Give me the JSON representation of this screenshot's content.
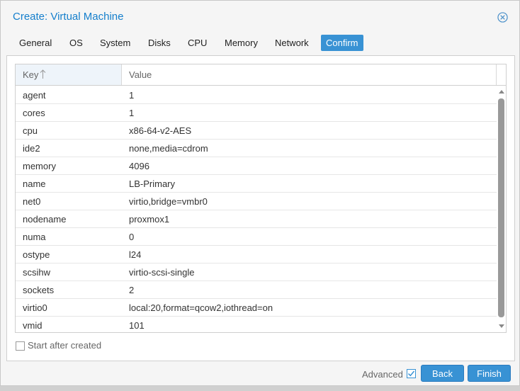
{
  "window": {
    "title": "Create: Virtual Machine"
  },
  "tabs": [
    {
      "label": "General"
    },
    {
      "label": "OS"
    },
    {
      "label": "System"
    },
    {
      "label": "Disks"
    },
    {
      "label": "CPU"
    },
    {
      "label": "Memory"
    },
    {
      "label": "Network"
    },
    {
      "label": "Confirm",
      "active": true
    }
  ],
  "grid": {
    "columns": [
      "Key",
      "Value"
    ],
    "rows": [
      {
        "key": "agent",
        "value": "1"
      },
      {
        "key": "cores",
        "value": "1"
      },
      {
        "key": "cpu",
        "value": "x86-64-v2-AES"
      },
      {
        "key": "ide2",
        "value": "none,media=cdrom"
      },
      {
        "key": "memory",
        "value": "4096"
      },
      {
        "key": "name",
        "value": "LB-Primary"
      },
      {
        "key": "net0",
        "value": "virtio,bridge=vmbr0"
      },
      {
        "key": "nodename",
        "value": "proxmox1"
      },
      {
        "key": "numa",
        "value": "0"
      },
      {
        "key": "ostype",
        "value": "l24"
      },
      {
        "key": "scsihw",
        "value": "virtio-scsi-single"
      },
      {
        "key": "sockets",
        "value": "2"
      },
      {
        "key": "virtio0",
        "value": "local:20,format=qcow2,iothread=on"
      },
      {
        "key": "vmid",
        "value": "101"
      }
    ]
  },
  "start_after_created": {
    "label": "Start after created",
    "checked": false
  },
  "footer": {
    "advanced_label": "Advanced",
    "advanced_checked": true,
    "back_label": "Back",
    "finish_label": "Finish"
  },
  "colors": {
    "accent": "#3892d4",
    "title": "#157fcc"
  },
  "icons": {
    "close": "close-circle-icon",
    "sort": "sort-ascending-icon",
    "check": "checkmark-icon"
  }
}
